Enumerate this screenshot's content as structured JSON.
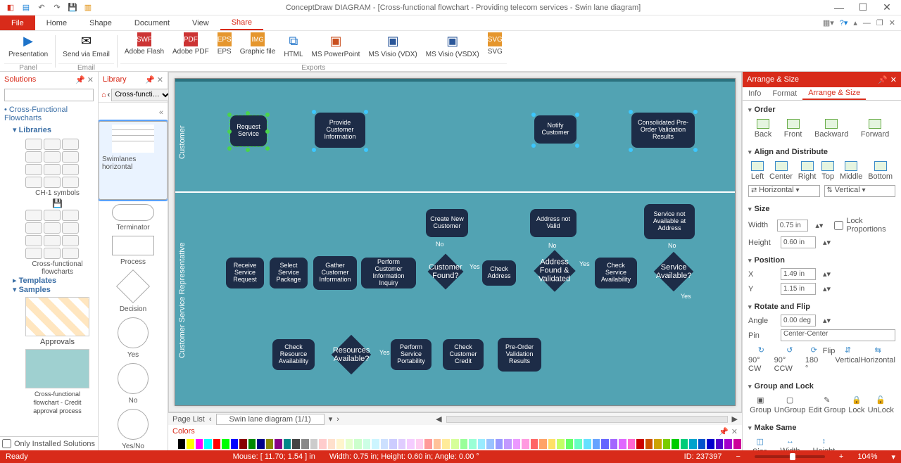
{
  "title": "ConceptDraw DIAGRAM - [Cross-functional flowchart - Providing telecom services - Swin lane diagram]",
  "menu": {
    "file": "File",
    "home": "Home",
    "shape": "Shape",
    "document": "Document",
    "view": "View",
    "share": "Share"
  },
  "ribbon": {
    "presentation": "Presentation",
    "sendEmail": "Send via Email",
    "adobeFlash": "Adobe Flash",
    "adobePdf": "Adobe PDF",
    "eps": "EPS",
    "graphicFile": "Graphic file",
    "html": "HTML",
    "msPpt": "MS PowerPoint",
    "visioVdx": "MS Visio (VDX)",
    "visioVsdx": "MS Visio (VSDX)",
    "svg": "SVG",
    "groupPanel": "Panel",
    "groupEmail": "Email",
    "groupExports": "Exports"
  },
  "solutions": {
    "title": "Solutions",
    "crossFunc": "Cross-Functional Flowcharts",
    "libraries": "Libraries",
    "ch1": "CH-1 symbols",
    "cff": "Cross-functional flowcharts",
    "templates": "Templates",
    "samples": "Samples",
    "approvals": "Approvals",
    "credit": "Cross-functional flowchart - Credit approval process",
    "onlyInstalled": "Only Installed Solutions"
  },
  "library": {
    "title": "Library",
    "dropdown": "Cross-functi…",
    "swim": "Swimlanes horizontal",
    "terminator": "Terminator",
    "process": "Process",
    "decision": "Decision",
    "yes": "Yes",
    "no": "No",
    "yesno": "Yes/No"
  },
  "canvas": {
    "laneCustomer": "Customer",
    "laneCSR": "Customer Service Representative",
    "n_request": "Request Service",
    "n_provide": "Provide Customer Information",
    "n_notify": "Notify Customer",
    "n_consolidated": "Consolidated Pre-Order Validation Results",
    "n_create": "Create New Customer",
    "n_addrnv": "Address not Valid",
    "n_svcnaa": "Service not Available at Address",
    "n_receive": "Receive Service Request",
    "n_selpkg": "Select Service Package",
    "n_gather": "Gather Customer Information",
    "n_perfinq": "Perform Customer Information Inquiry",
    "n_custfound": "Customer Found?",
    "n_chkaddr": "Check Address",
    "n_addrval": "Address Found & Validated",
    "n_chksvcav": "Check Service Availability",
    "n_svcav": "Service Available?",
    "n_chkres": "Check Resource Availability",
    "n_resav": "Resources Available?",
    "n_perfport": "Perform Service Portability",
    "n_chkcredit": "Check Customer Credit",
    "n_preorder": "Pre-Order Validation Results",
    "yes": "Yes",
    "no": "No"
  },
  "tabs": {
    "pageList": "Page List",
    "pageSel": "Swin lane diagram (1/1)"
  },
  "colors": {
    "title": "Colors"
  },
  "arrange": {
    "title": "Arrange & Size",
    "tabInfo": "Info",
    "tabFormat": "Format",
    "tabArrange": "Arrange & Size",
    "order": "Order",
    "back": "Back",
    "front": "Front",
    "backward": "Backward",
    "forward": "Forward",
    "align": "Align and Distribute",
    "left": "Left",
    "center": "Center",
    "right": "Right",
    "top": "Top",
    "middle": "Middle",
    "bottom": "Bottom",
    "horiz": "Horizontal",
    "vert": "Vertical",
    "size": "Size",
    "width": "Width",
    "height": "Height",
    "wval": "0.75 in",
    "hval": "0.60 in",
    "lockProp": "Lock Proportions",
    "position": "Position",
    "x": "X",
    "y": "Y",
    "xval": "1.49 in",
    "yval": "1.15 in",
    "rotate": "Rotate and Flip",
    "angle": "Angle",
    "aval": "0.00 deg",
    "pin": "Pin",
    "pinval": "Center-Center",
    "cw": "90° CW",
    "ccw": "90° CCW",
    "r180": "180 °",
    "flip": "Flip",
    "fv": "Vertical",
    "fh": "Horizontal",
    "grouplock": "Group and Lock",
    "group": "Group",
    "ungroup": "UnGroup",
    "editgroup": "Edit Group",
    "lock": "Lock",
    "unlock": "UnLock",
    "makesame": "Make Same",
    "msize": "Size",
    "mwidth": "Width",
    "mheight": "Height"
  },
  "status": {
    "ready": "Ready",
    "mouse": "Mouse: [ 11.70; 1.54 ] in",
    "dims": "Width: 0.75 in; Height: 0.60 in; Angle: 0.00 °",
    "id": "ID: 237397",
    "zoom": "104%"
  }
}
